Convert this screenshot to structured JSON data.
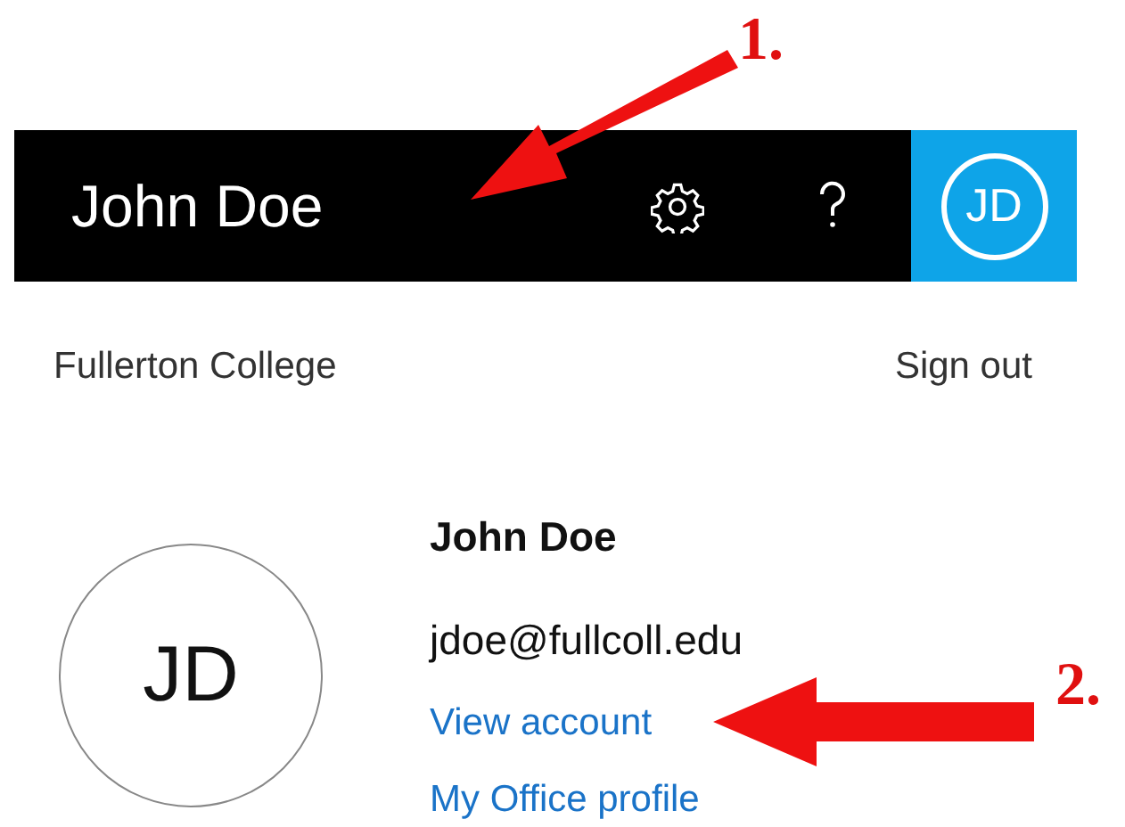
{
  "header": {
    "name": "John Doe",
    "initials": "JD"
  },
  "org": "Fullerton College",
  "sign_out": "Sign out",
  "profile": {
    "initials": "JD",
    "name": "John Doe",
    "email": "jdoe@fullcoll.edu",
    "links": [
      "View account",
      "My Office profile"
    ]
  },
  "annotations": [
    {
      "label": "1."
    },
    {
      "label": "2."
    }
  ]
}
